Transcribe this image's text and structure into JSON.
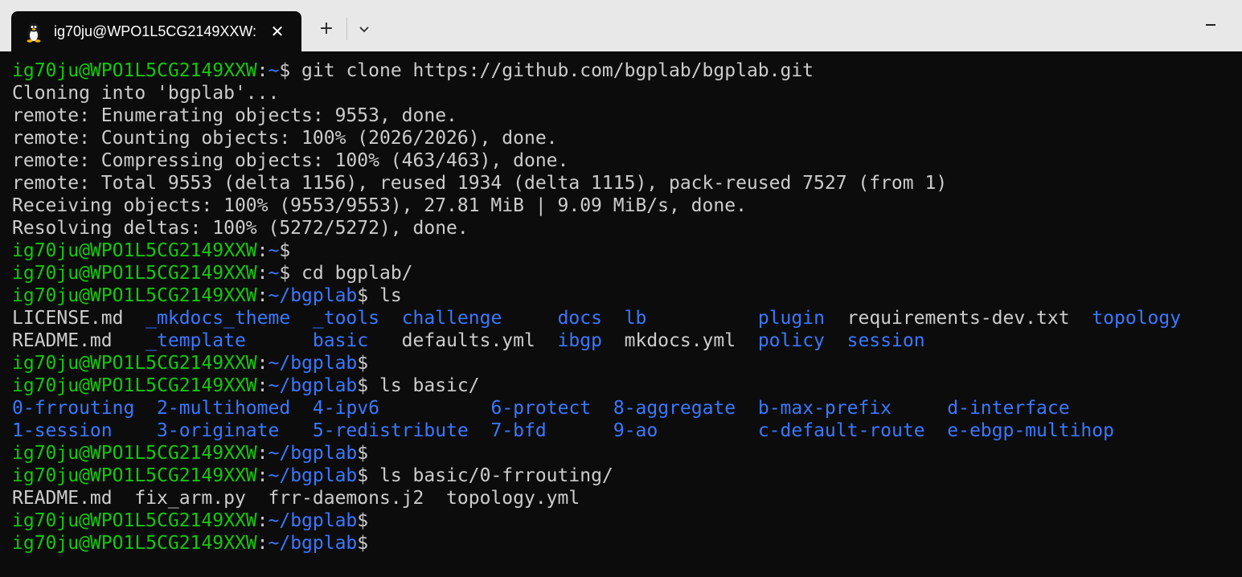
{
  "window": {
    "tab_title": "ig70ju@WPO1L5CG2149XXW:",
    "tab_icon": "linux-penguin-icon",
    "close_glyph": "✕",
    "new_tab_glyph": "+",
    "dropdown_icon": "chevron-down-icon",
    "minimize_icon": "minimize-icon"
  },
  "colors": {
    "background": "#0c0c0c",
    "text": "#cccccc",
    "user_host": "#16c60c",
    "path": "#3b78ff",
    "directory": "#3b78ff",
    "titlebar": "#e8e8e8"
  },
  "terminal": {
    "lines": [
      [
        {
          "t": "ig70ju@WPO1L5CG2149XXW",
          "c": "u"
        },
        {
          "t": ":",
          "c": "t"
        },
        {
          "t": "~",
          "c": "p"
        },
        {
          "t": "$ git clone https://github.com/bgplab/bgplab.git",
          "c": "t"
        }
      ],
      [
        {
          "t": "Cloning into 'bgplab'...",
          "c": "t"
        }
      ],
      [
        {
          "t": "remote: Enumerating objects: 9553, done.",
          "c": "t"
        }
      ],
      [
        {
          "t": "remote: Counting objects: 100% (2026/2026), done.",
          "c": "t"
        }
      ],
      [
        {
          "t": "remote: Compressing objects: 100% (463/463), done.",
          "c": "t"
        }
      ],
      [
        {
          "t": "remote: Total 9553 (delta 1156), reused 1934 (delta 1115), pack-reused 7527 (from 1)",
          "c": "t"
        }
      ],
      [
        {
          "t": "Receiving objects: 100% (9553/9553), 27.81 MiB | 9.09 MiB/s, done.",
          "c": "t"
        }
      ],
      [
        {
          "t": "Resolving deltas: 100% (5272/5272), done.",
          "c": "t"
        }
      ],
      [
        {
          "t": "ig70ju@WPO1L5CG2149XXW",
          "c": "u"
        },
        {
          "t": ":",
          "c": "t"
        },
        {
          "t": "~",
          "c": "p"
        },
        {
          "t": "$",
          "c": "t"
        }
      ],
      [
        {
          "t": "ig70ju@WPO1L5CG2149XXW",
          "c": "u"
        },
        {
          "t": ":",
          "c": "t"
        },
        {
          "t": "~",
          "c": "p"
        },
        {
          "t": "$ cd bgplab/",
          "c": "t"
        }
      ],
      [
        {
          "t": "ig70ju@WPO1L5CG2149XXW",
          "c": "u"
        },
        {
          "t": ":",
          "c": "t"
        },
        {
          "t": "~/bgplab",
          "c": "p"
        },
        {
          "t": "$ ls",
          "c": "t"
        }
      ],
      [
        {
          "t": "LICENSE.md  ",
          "c": "t"
        },
        {
          "t": "_mkdocs_theme",
          "c": "d"
        },
        {
          "t": "  ",
          "c": "t"
        },
        {
          "t": "_tools",
          "c": "d"
        },
        {
          "t": "  ",
          "c": "t"
        },
        {
          "t": "challenge",
          "c": "d"
        },
        {
          "t": "     ",
          "c": "t"
        },
        {
          "t": "docs",
          "c": "d"
        },
        {
          "t": "  ",
          "c": "t"
        },
        {
          "t": "lb",
          "c": "d"
        },
        {
          "t": "          ",
          "c": "t"
        },
        {
          "t": "plugin",
          "c": "d"
        },
        {
          "t": "  requirements-dev.txt  ",
          "c": "t"
        },
        {
          "t": "topology",
          "c": "d"
        }
      ],
      [
        {
          "t": "README.md   ",
          "c": "t"
        },
        {
          "t": "_template",
          "c": "d"
        },
        {
          "t": "      ",
          "c": "t"
        },
        {
          "t": "basic",
          "c": "d"
        },
        {
          "t": "   defaults.yml  ",
          "c": "t"
        },
        {
          "t": "ibgp",
          "c": "d"
        },
        {
          "t": "  mkdocs.yml  ",
          "c": "t"
        },
        {
          "t": "policy",
          "c": "d"
        },
        {
          "t": "  ",
          "c": "t"
        },
        {
          "t": "session",
          "c": "d"
        }
      ],
      [
        {
          "t": "ig70ju@WPO1L5CG2149XXW",
          "c": "u"
        },
        {
          "t": ":",
          "c": "t"
        },
        {
          "t": "~/bgplab",
          "c": "p"
        },
        {
          "t": "$",
          "c": "t"
        }
      ],
      [
        {
          "t": "ig70ju@WPO1L5CG2149XXW",
          "c": "u"
        },
        {
          "t": ":",
          "c": "t"
        },
        {
          "t": "~/bgplab",
          "c": "p"
        },
        {
          "t": "$ ls basic/",
          "c": "t"
        }
      ],
      [
        {
          "t": "0-frrouting",
          "c": "d"
        },
        {
          "t": "  ",
          "c": "t"
        },
        {
          "t": "2-multihomed",
          "c": "d"
        },
        {
          "t": "  ",
          "c": "t"
        },
        {
          "t": "4-ipv6",
          "c": "d"
        },
        {
          "t": "          ",
          "c": "t"
        },
        {
          "t": "6-protect",
          "c": "d"
        },
        {
          "t": "  ",
          "c": "t"
        },
        {
          "t": "8-aggregate",
          "c": "d"
        },
        {
          "t": "  ",
          "c": "t"
        },
        {
          "t": "b-max-prefix",
          "c": "d"
        },
        {
          "t": "     ",
          "c": "t"
        },
        {
          "t": "d-interface",
          "c": "d"
        }
      ],
      [
        {
          "t": "1-session",
          "c": "d"
        },
        {
          "t": "    ",
          "c": "t"
        },
        {
          "t": "3-originate",
          "c": "d"
        },
        {
          "t": "   ",
          "c": "t"
        },
        {
          "t": "5-redistribute",
          "c": "d"
        },
        {
          "t": "  ",
          "c": "t"
        },
        {
          "t": "7-bfd",
          "c": "d"
        },
        {
          "t": "      ",
          "c": "t"
        },
        {
          "t": "9-ao",
          "c": "d"
        },
        {
          "t": "         ",
          "c": "t"
        },
        {
          "t": "c-default-route",
          "c": "d"
        },
        {
          "t": "  ",
          "c": "t"
        },
        {
          "t": "e-ebgp-multihop",
          "c": "d"
        }
      ],
      [
        {
          "t": "ig70ju@WPO1L5CG2149XXW",
          "c": "u"
        },
        {
          "t": ":",
          "c": "t"
        },
        {
          "t": "~/bgplab",
          "c": "p"
        },
        {
          "t": "$",
          "c": "t"
        }
      ],
      [
        {
          "t": "ig70ju@WPO1L5CG2149XXW",
          "c": "u"
        },
        {
          "t": ":",
          "c": "t"
        },
        {
          "t": "~/bgplab",
          "c": "p"
        },
        {
          "t": "$ ls basic/0-frrouting/",
          "c": "t"
        }
      ],
      [
        {
          "t": "README.md  fix_arm.py  frr-daemons.j2  topology.yml",
          "c": "t"
        }
      ],
      [
        {
          "t": "ig70ju@WPO1L5CG2149XXW",
          "c": "u"
        },
        {
          "t": ":",
          "c": "t"
        },
        {
          "t": "~/bgplab",
          "c": "p"
        },
        {
          "t": "$",
          "c": "t"
        }
      ],
      [
        {
          "t": "ig70ju@WPO1L5CG2149XXW",
          "c": "u"
        },
        {
          "t": ":",
          "c": "t"
        },
        {
          "t": "~/bgplab",
          "c": "p"
        },
        {
          "t": "$",
          "c": "t"
        }
      ]
    ]
  }
}
